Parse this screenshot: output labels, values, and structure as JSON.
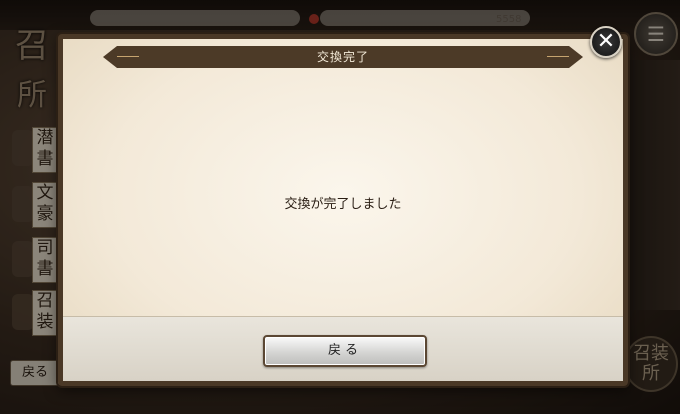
{
  "background": {
    "left_title_top": "召",
    "left_title_bottom": "所",
    "top_counter": "5558",
    "side_tiles": [
      {
        "top": "潜",
        "bottom": "書"
      },
      {
        "top": "文",
        "bottom": "豪"
      },
      {
        "top": "司",
        "bottom": "書"
      },
      {
        "top": "召",
        "bottom": "装"
      }
    ],
    "back_button_label": "戻る",
    "menu_icon": "list-menu-icon",
    "seal_line1": "召装",
    "seal_line2": "所"
  },
  "dialog": {
    "title": "交換完了",
    "message": "交換が完了しました",
    "back_button_label": "戻る",
    "close_icon": "close-icon",
    "colors": {
      "banner": "#4c3a27",
      "frame": "#4a3826",
      "parchment": "#f3e9d8"
    }
  }
}
